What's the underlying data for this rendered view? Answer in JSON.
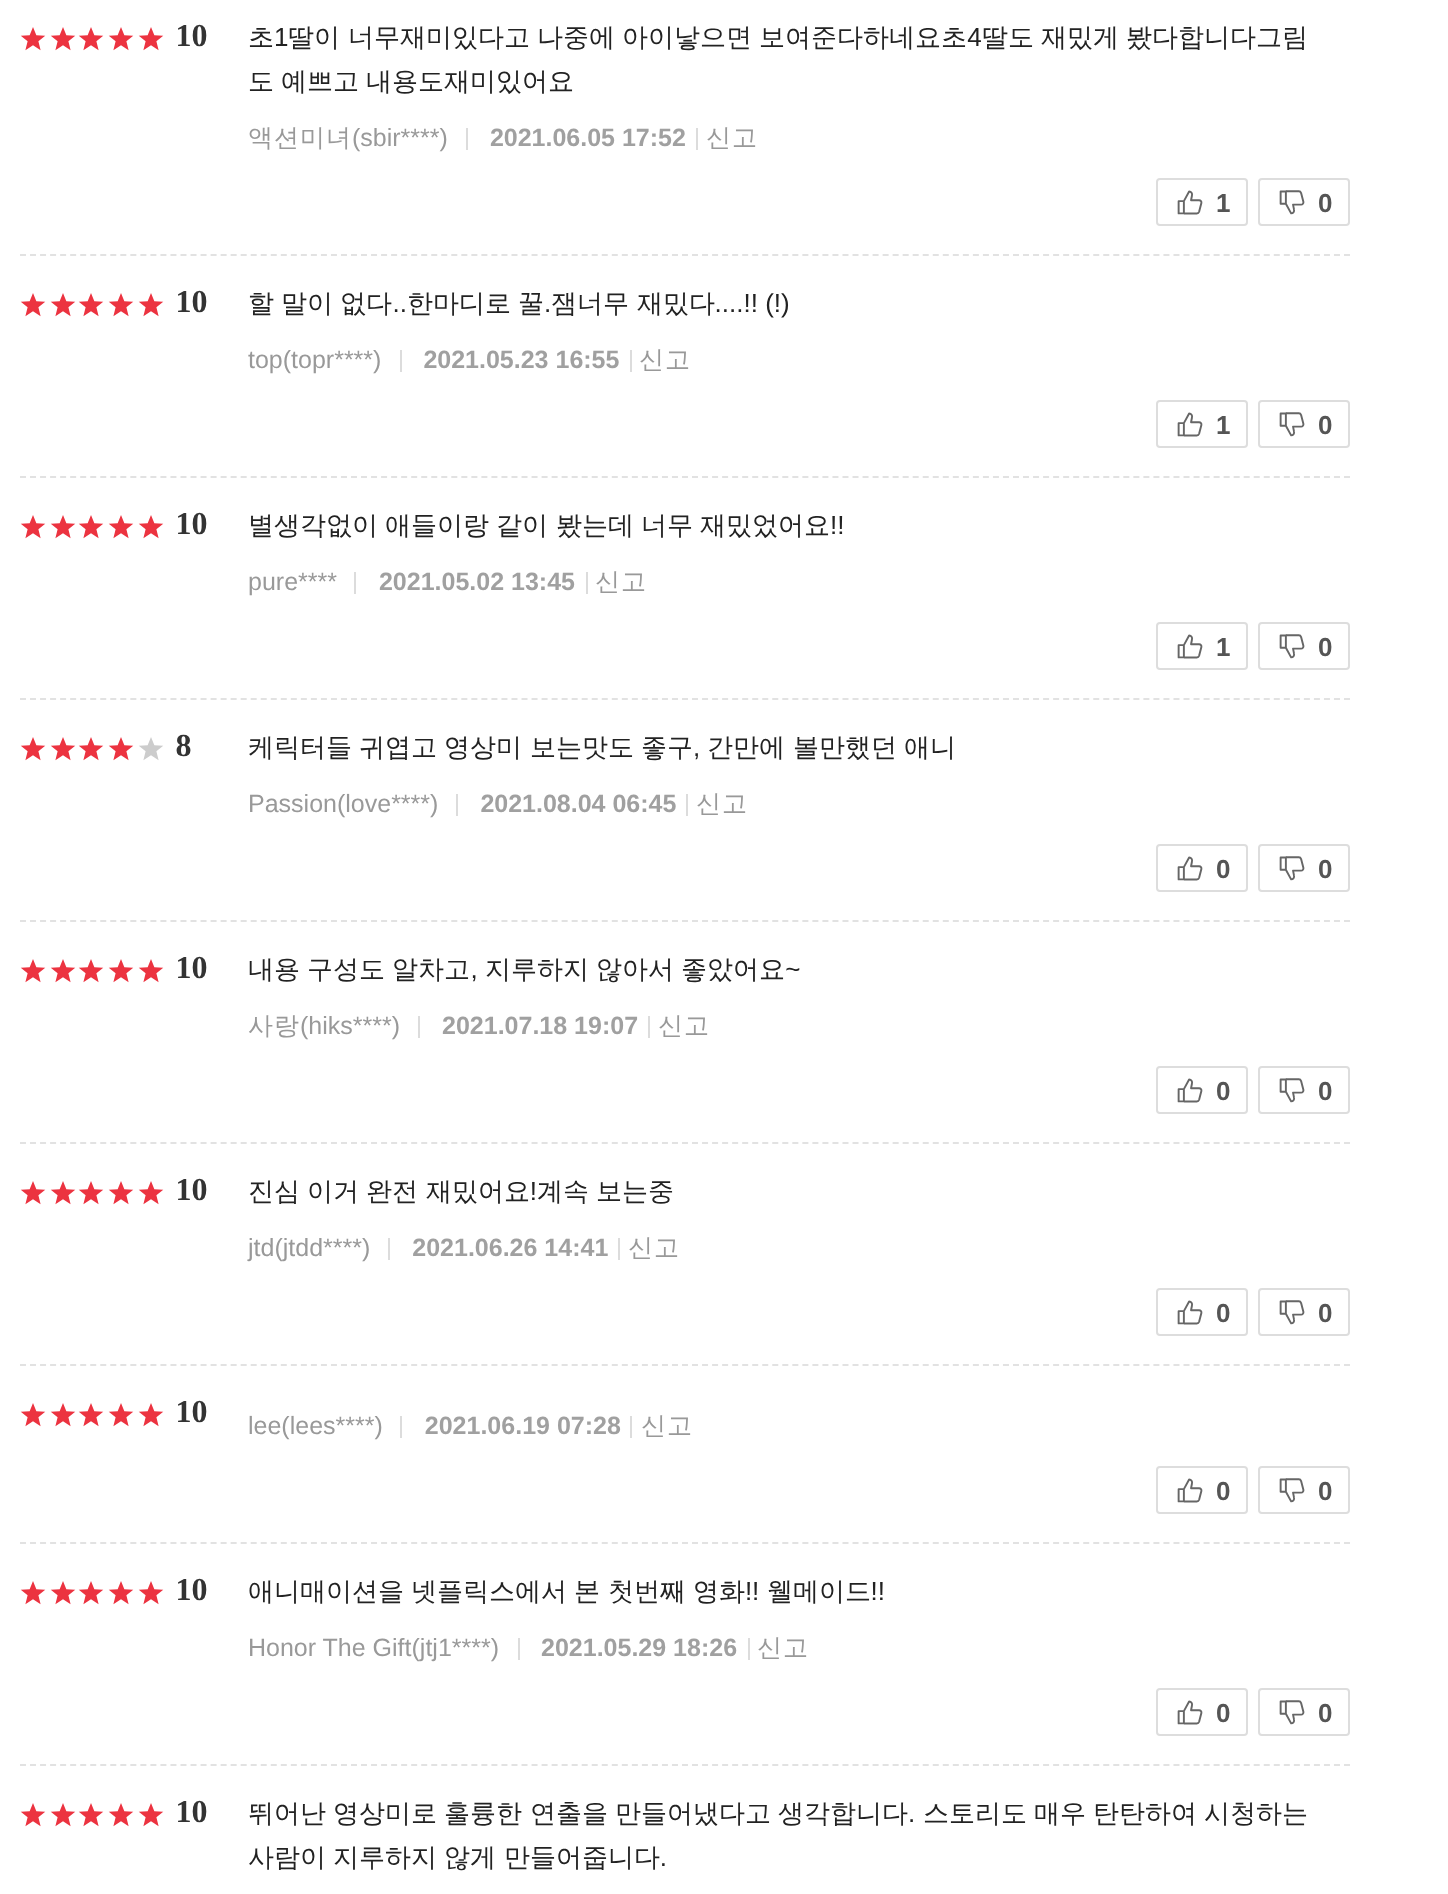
{
  "reviews": [
    {
      "stars": 5,
      "score": "10",
      "comment": "초1딸이 너무재미있다고 나중에 아이낳으면 보여준다하네요초4딸도 재밌게 봤다합니다그림도 예쁘고 내용도재미있어요",
      "nickname": "액션미녀(sbir****)",
      "date": "2021.06.05 17:52",
      "report": "신고",
      "likes": "1",
      "dislikes": "0"
    },
    {
      "stars": 5,
      "score": "10",
      "comment": "할 말이 없다..한마디로 꿀.잼너무 재밌다....!! (!)",
      "nickname": "top(topr****)",
      "date": "2021.05.23 16:55",
      "report": "신고",
      "likes": "1",
      "dislikes": "0"
    },
    {
      "stars": 5,
      "score": "10",
      "comment": "별생각없이 애들이랑 같이 봤는데 너무 재밌었어요!!",
      "nickname": "pure****",
      "date": "2021.05.02 13:45",
      "report": "신고",
      "likes": "1",
      "dislikes": "0"
    },
    {
      "stars": 4,
      "score": "8",
      "comment": "케릭터들 귀엽고 영상미 보는맛도 좋구, 간만에 볼만했던 애니",
      "nickname": "Passion(love****)",
      "date": "2021.08.04 06:45",
      "report": "신고",
      "likes": "0",
      "dislikes": "0"
    },
    {
      "stars": 5,
      "score": "10",
      "comment": "내용 구성도 알차고, 지루하지 않아서 좋았어요~",
      "nickname": "사랑(hiks****)",
      "date": "2021.07.18 19:07",
      "report": "신고",
      "likes": "0",
      "dislikes": "0"
    },
    {
      "stars": 5,
      "score": "10",
      "comment": "진심 이거 완전 재밌어요!계속 보는중",
      "nickname": "jtd(jtdd****)",
      "date": "2021.06.26 14:41",
      "report": "신고",
      "likes": "0",
      "dislikes": "0"
    },
    {
      "stars": 5,
      "score": "10",
      "nickname": "lee(lees****)",
      "date": "2021.06.19 07:28",
      "report": "신고",
      "likes": "0",
      "dislikes": "0"
    },
    {
      "stars": 5,
      "score": "10",
      "comment": "애니매이션을 넷플릭스에서 본 첫번째 영화!! 웰메이드!!",
      "nickname": "Honor The Gift(jtj1****)",
      "date": "2021.05.29 18:26",
      "report": "신고",
      "likes": "0",
      "dislikes": "0"
    },
    {
      "stars": 5,
      "score": "10",
      "comment": "뛰어난 영상미로 훌륭한 연출을 만들어냈다고 생각합니다. 스토리도 매우 탄탄하여 시청하는 사람이 지루하지 않게 만들어줍니다."
    }
  ]
}
